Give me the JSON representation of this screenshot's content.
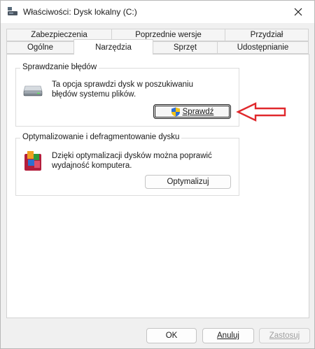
{
  "window": {
    "title": "Właściwości: Dysk lokalny (C:)"
  },
  "tabs": {
    "row_top": [
      {
        "label": "Zabezpieczenia"
      },
      {
        "label": "Poprzednie wersje"
      },
      {
        "label": "Przydział"
      }
    ],
    "row_bottom": [
      {
        "label": "Ogólne"
      },
      {
        "label": "Narzędzia",
        "active": true
      },
      {
        "label": "Sprzęt"
      },
      {
        "label": "Udostępnianie"
      }
    ]
  },
  "error_checking": {
    "title": "Sprawdzanie błędów",
    "description_line1": "Ta opcja sprawdzi dysk w poszukiwaniu",
    "description_line2": "błędów systemu plików.",
    "button_label": "Sprawdź",
    "icon": "drive-icon"
  },
  "optimize": {
    "title": "Optymalizowanie i defragmentowanie dysku",
    "description_line1": "Dzięki optymalizacji dysków można poprawić",
    "description_line2": "wydajność komputera.",
    "button_label": "Optymalizuj",
    "icon": "defrag-icon"
  },
  "annotation": {
    "arrow_color": "#e0282c"
  },
  "footer": {
    "ok_label": "OK",
    "cancel_label": "Anuluj",
    "apply_label": "Zastosuj"
  }
}
